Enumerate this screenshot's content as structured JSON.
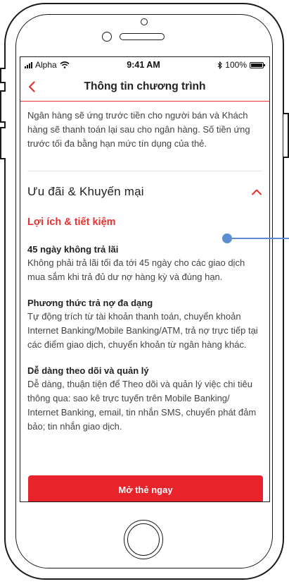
{
  "status_bar": {
    "carrier": "Alpha",
    "time": "9:41 AM",
    "battery": "100%"
  },
  "nav": {
    "title": "Thông tin chương trình"
  },
  "intro_text": "Ngân hàng sẽ ứng trước tiền cho người bán và Khách hàng sẽ thanh toán lại sau cho ngân hàng. Số tiền ứng trước tối đa bằng hạn mức tín dụng của thẻ.",
  "section": {
    "title": "Ưu đãi & Khuyến mại",
    "subtitle": "Lợi ích & tiết kiệm",
    "items": [
      {
        "title": "45 ngày không trả lãi",
        "desc": "Không phải trả lãi tối đa tới 45 ngày cho các giao dịch mua sắm khi trả đủ dư nợ hàng kỳ và đúng hạn."
      },
      {
        "title": "Phương thức trả nợ đa dạng",
        "desc": "Tự động trích từ tài khoản thanh toán, chuyển khoản Internet Banking/Mobile Banking/ATM, trả nợ trực tiếp tại các điểm giao dịch, chuyển khoản từ ngân hàng khác."
      },
      {
        "title": "Dễ dàng theo dõi và quản lý",
        "desc": "Dễ dàng, thuận tiện để Theo dõi và quản lý việc chi tiêu thông qua: sao kê trực tuyến trên Mobile Banking/ Internet Banking, email, tin nhắn SMS, chuyển phát đảm bảo; tin nhắn giao dịch."
      }
    ]
  },
  "cta": {
    "label": "Mở thẻ ngay"
  },
  "colors": {
    "accent": "#e8322f",
    "button": "#e8232b",
    "annotation": "#5b8fcf"
  }
}
